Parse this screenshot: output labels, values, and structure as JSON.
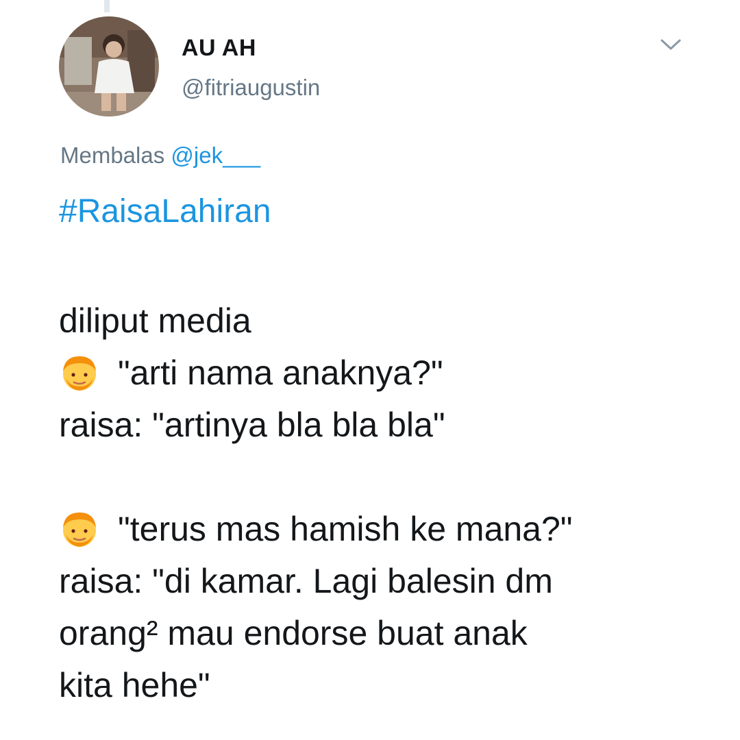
{
  "tweet": {
    "author": {
      "display_name": "AU AH",
      "handle": "@fitriaugustin",
      "avatar_icon": "profile-photo-avatar"
    },
    "menu_icon": "chevron-down-icon",
    "reply_to": {
      "prefix": "Membalas",
      "mention": "@jek___"
    },
    "hashtag": "#RaisaLahiran",
    "lines": {
      "l1": "diliput media",
      "l2": "\"arti nama anaknya?\"",
      "l3": "raisa: \"artinya bla bla bla\"",
      "l4": "\"terus mas hamish ke mana?\"",
      "l5": "raisa: \"di kamar. Lagi balesin dm",
      "l6": "orang² mau endorse buat anak",
      "l7": "kita hehe\""
    },
    "emoji_icon": "man-emoji-icon"
  },
  "colors": {
    "text": "#14171a",
    "secondary": "#657786",
    "link": "#1b95e0",
    "emoji_skin": "#ffcc4d",
    "emoji_hair": "#f4900c"
  }
}
